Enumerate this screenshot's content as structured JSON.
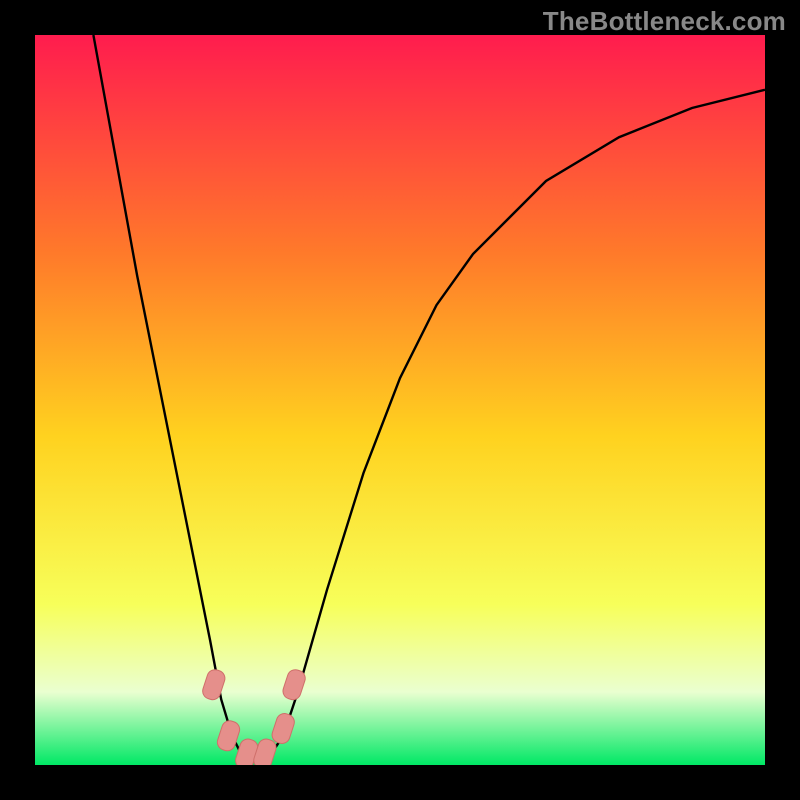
{
  "watermark": "TheBottleneck.com",
  "colors": {
    "frame": "#000000",
    "gradient_top": "#ff1c4e",
    "gradient_upper_mid": "#ff7a2a",
    "gradient_mid": "#ffd21f",
    "gradient_lower_mid": "#f7ff5a",
    "gradient_pale": "#eaffd0",
    "gradient_green": "#00e865",
    "curve": "#000000",
    "marker_fill": "#e58f8b",
    "marker_stroke": "#cf6f6a"
  },
  "chart_data": {
    "type": "line",
    "title": "",
    "xlabel": "",
    "ylabel": "",
    "xlim": [
      0,
      100
    ],
    "ylim": [
      0,
      100
    ],
    "series": [
      {
        "name": "bottleneck-curve",
        "x": [
          8,
          10,
          12,
          14,
          16,
          18,
          20,
          22,
          24,
          25.5,
          27,
          28.5,
          30,
          32,
          34,
          36,
          40,
          45,
          50,
          55,
          60,
          70,
          80,
          90,
          100
        ],
        "values": [
          100,
          89,
          78,
          67,
          57,
          47,
          37,
          27,
          17,
          9,
          4,
          1,
          0.5,
          1,
          4,
          10,
          24,
          40,
          53,
          63,
          70,
          80,
          86,
          90,
          92.5
        ]
      }
    ],
    "markers": [
      {
        "x": 24.5,
        "y": 11
      },
      {
        "x": 26.5,
        "y": 4
      },
      {
        "x": 29.0,
        "y": 1.5
      },
      {
        "x": 31.5,
        "y": 1.5
      },
      {
        "x": 34.0,
        "y": 5
      },
      {
        "x": 35.5,
        "y": 11
      }
    ]
  }
}
